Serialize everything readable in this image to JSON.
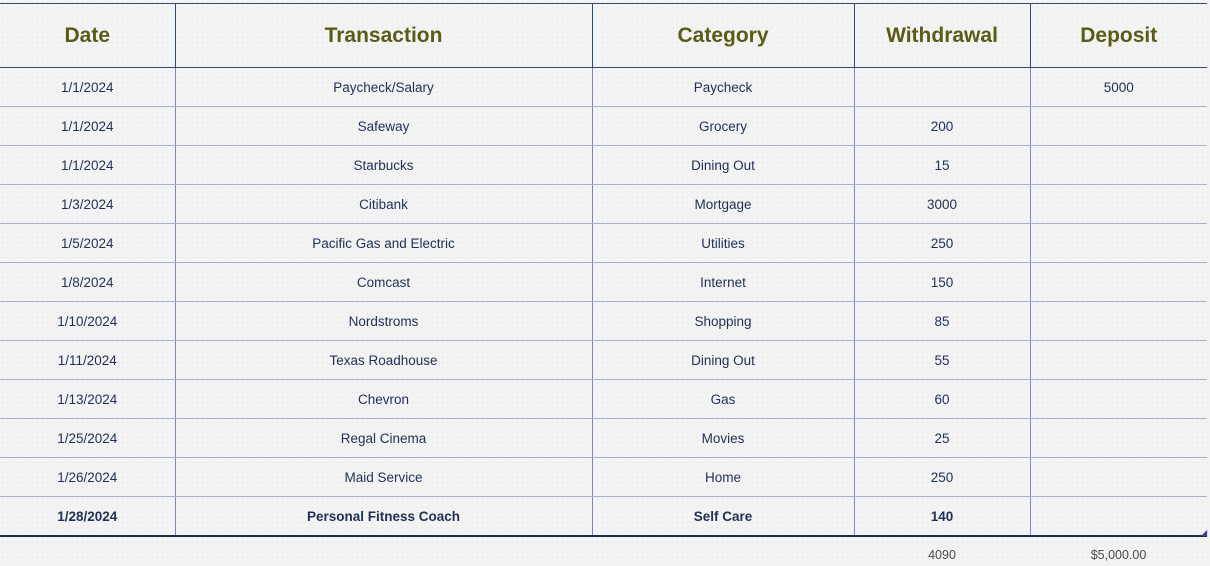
{
  "headers": [
    "Date",
    "Transaction",
    "Category",
    "Withdrawal",
    "Deposit"
  ],
  "rows": [
    [
      "1/1/2024",
      "Paycheck/Salary",
      "Paycheck",
      "",
      "5000"
    ],
    [
      "1/1/2024",
      "Safeway",
      "Grocery",
      "200",
      ""
    ],
    [
      "1/1/2024",
      "Starbucks",
      "Dining Out",
      "15",
      ""
    ],
    [
      "1/3/2024",
      "Citibank",
      "Mortgage",
      "3000",
      ""
    ],
    [
      "1/5/2024",
      "Pacific Gas and Electric",
      "Utilities",
      "250",
      ""
    ],
    [
      "1/8/2024",
      "Comcast",
      "Internet",
      "150",
      ""
    ],
    [
      "1/10/2024",
      "Nordstroms",
      "Shopping",
      "85",
      ""
    ],
    [
      "1/11/2024",
      "Texas Roadhouse",
      "Dining Out",
      "55",
      ""
    ],
    [
      "1/13/2024",
      "Chevron",
      "Gas",
      "60",
      ""
    ],
    [
      "1/25/2024",
      "Regal Cinema",
      "Movies",
      "25",
      ""
    ],
    [
      "1/26/2024",
      "Maid Service",
      "Home",
      "250",
      ""
    ],
    [
      "1/28/2024",
      "Personal Fitness Coach",
      "Self Care",
      "140",
      ""
    ]
  ],
  "totals": {
    "withdrawal": "4090",
    "deposit": "$5,000.00"
  },
  "colors": {
    "header_text": "#5b5b18",
    "cell_text": "#1f2f55",
    "border": "#2e4a86",
    "background": "#f3f3f3"
  }
}
